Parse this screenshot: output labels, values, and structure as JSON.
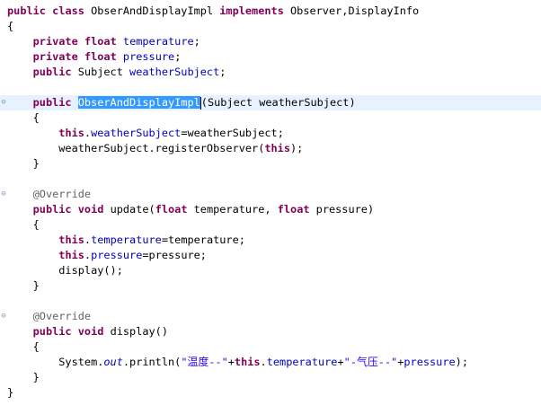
{
  "editor": {
    "colors": {
      "keyword": "#7f0055",
      "field": "#0000c0",
      "annotation": "#646464",
      "string": "#2a00ff",
      "selection": "#3399ff",
      "current_line": "#e8f2fe"
    },
    "lines": [
      {
        "tokens": [
          [
            "kw",
            "public"
          ],
          [
            "t",
            " "
          ],
          [
            "kw",
            "class"
          ],
          [
            "t",
            " ObserAndDisplayImpl "
          ],
          [
            "kw",
            "implements"
          ],
          [
            "t",
            " Observer,DisplayInfo"
          ]
        ]
      },
      {
        "tokens": [
          [
            "t",
            "{"
          ]
        ]
      },
      {
        "tokens": [
          [
            "t",
            "    "
          ],
          [
            "kw",
            "private"
          ],
          [
            "t",
            " "
          ],
          [
            "kw",
            "float"
          ],
          [
            "t",
            " "
          ],
          [
            "fld",
            "temperature"
          ],
          [
            "t",
            ";"
          ]
        ]
      },
      {
        "tokens": [
          [
            "t",
            "    "
          ],
          [
            "kw",
            "private"
          ],
          [
            "t",
            " "
          ],
          [
            "kw",
            "float"
          ],
          [
            "t",
            " "
          ],
          [
            "fld",
            "pressure"
          ],
          [
            "t",
            ";"
          ]
        ]
      },
      {
        "tokens": [
          [
            "t",
            "    "
          ],
          [
            "kw",
            "public"
          ],
          [
            "t",
            " Subject "
          ],
          [
            "fld",
            "weatherSubject"
          ],
          [
            "t",
            ";"
          ]
        ]
      },
      {
        "tokens": [
          [
            "t",
            ""
          ]
        ]
      },
      {
        "fold": "⊖",
        "current": true,
        "tokens": [
          [
            "t",
            "    "
          ],
          [
            "kw",
            "public"
          ],
          [
            "t",
            " "
          ],
          [
            "sel",
            "ObserAndDisplayImpl"
          ],
          [
            "caret",
            ""
          ],
          [
            "t",
            "(Subject weatherSubject)"
          ]
        ]
      },
      {
        "tokens": [
          [
            "t",
            "    {"
          ]
        ]
      },
      {
        "tokens": [
          [
            "t",
            "        "
          ],
          [
            "kw",
            "this"
          ],
          [
            "t",
            "."
          ],
          [
            "fld",
            "weatherSubject"
          ],
          [
            "t",
            "=weatherSubject;"
          ]
        ]
      },
      {
        "tokens": [
          [
            "t",
            "        weatherSubject.registerObserver("
          ],
          [
            "kw",
            "this"
          ],
          [
            "t",
            ");"
          ]
        ]
      },
      {
        "tokens": [
          [
            "t",
            "    }"
          ]
        ]
      },
      {
        "tokens": [
          [
            "t",
            ""
          ]
        ]
      },
      {
        "fold": "⊖",
        "tokens": [
          [
            "t",
            "    "
          ],
          [
            "ann",
            "@Override"
          ]
        ]
      },
      {
        "tokens": [
          [
            "t",
            "    "
          ],
          [
            "kw",
            "public"
          ],
          [
            "t",
            " "
          ],
          [
            "kw",
            "void"
          ],
          [
            "t",
            " update("
          ],
          [
            "kw",
            "float"
          ],
          [
            "t",
            " temperature, "
          ],
          [
            "kw",
            "float"
          ],
          [
            "t",
            " pressure)"
          ]
        ]
      },
      {
        "tokens": [
          [
            "t",
            "    {"
          ]
        ]
      },
      {
        "tokens": [
          [
            "t",
            "        "
          ],
          [
            "kw",
            "this"
          ],
          [
            "t",
            "."
          ],
          [
            "fld",
            "temperature"
          ],
          [
            "t",
            "=temperature;"
          ]
        ]
      },
      {
        "tokens": [
          [
            "t",
            "        "
          ],
          [
            "kw",
            "this"
          ],
          [
            "t",
            "."
          ],
          [
            "fld",
            "pressure"
          ],
          [
            "t",
            "=pressure;"
          ]
        ]
      },
      {
        "tokens": [
          [
            "t",
            "        display();"
          ]
        ]
      },
      {
        "tokens": [
          [
            "t",
            "    }"
          ]
        ]
      },
      {
        "tokens": [
          [
            "t",
            ""
          ]
        ]
      },
      {
        "fold": "⊖",
        "tokens": [
          [
            "t",
            "    "
          ],
          [
            "ann",
            "@Override"
          ]
        ]
      },
      {
        "tokens": [
          [
            "t",
            "    "
          ],
          [
            "kw",
            "public"
          ],
          [
            "t",
            " "
          ],
          [
            "kw",
            "void"
          ],
          [
            "t",
            " display()"
          ]
        ]
      },
      {
        "tokens": [
          [
            "t",
            "    {"
          ]
        ]
      },
      {
        "tokens": [
          [
            "t",
            "        System."
          ],
          [
            "stat",
            "out"
          ],
          [
            "t",
            ".println("
          ],
          [
            "str",
            "\"温度--\""
          ],
          [
            "t",
            "+"
          ],
          [
            "kw",
            "this"
          ],
          [
            "t",
            "."
          ],
          [
            "fld",
            "temperature"
          ],
          [
            "t",
            "+"
          ],
          [
            "str",
            "\"-气压--\""
          ],
          [
            "t",
            "+"
          ],
          [
            "fld",
            "pressure"
          ],
          [
            "t",
            ");"
          ]
        ]
      },
      {
        "tokens": [
          [
            "t",
            "    }"
          ]
        ]
      },
      {
        "tokens": [
          [
            "t",
            "}"
          ]
        ]
      }
    ]
  }
}
